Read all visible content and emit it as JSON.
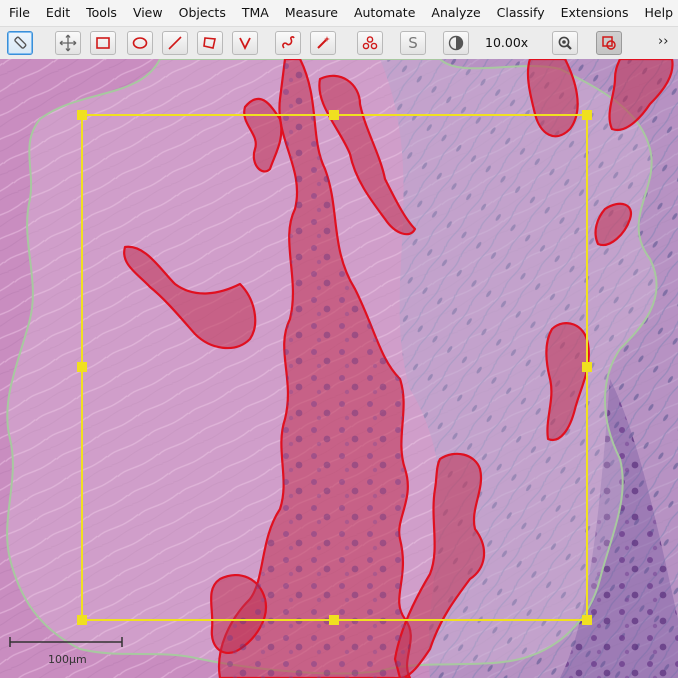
{
  "menu": {
    "items": [
      "File",
      "Edit",
      "Tools",
      "View",
      "Objects",
      "TMA",
      "Measure",
      "Automate",
      "Analyze",
      "Classify",
      "Extensions",
      "Help"
    ]
  },
  "toolbar": {
    "zoom_label": "10.00x",
    "overflow": "››",
    "text_button": "S",
    "tools": [
      {
        "name": "brush-tool",
        "icon": "pen-icon",
        "state": "selected"
      },
      {
        "name": "move-tool",
        "icon": "move-icon"
      },
      {
        "name": "rectangle-tool",
        "icon": "rectangle-icon"
      },
      {
        "name": "ellipse-tool",
        "icon": "ellipse-icon"
      },
      {
        "name": "line-tool",
        "icon": "line-icon"
      },
      {
        "name": "polygon-tool",
        "icon": "polygon-icon"
      },
      {
        "name": "polyline-tool",
        "icon": "polyline-icon"
      },
      {
        "name": "freehand-tool",
        "icon": "freehand-icon"
      },
      {
        "name": "wand-tool",
        "icon": "wand-icon"
      },
      {
        "name": "points-tool",
        "icon": "points-icon"
      },
      {
        "name": "show-names-toggle",
        "icon": "text-icon"
      },
      {
        "name": "brightness-contrast-button",
        "icon": "contrast-icon"
      },
      {
        "name": "zoom-to-fit-button",
        "icon": "zoom-icon"
      },
      {
        "name": "show-overlay-toggle",
        "icon": "overlay-icon",
        "state": "pressed"
      }
    ]
  },
  "viewer": {
    "scalebar_label": "100µm",
    "annotation_colors": {
      "tumor": "#e01020",
      "selected": "#f0e020",
      "region": "#a8c8a0"
    }
  }
}
